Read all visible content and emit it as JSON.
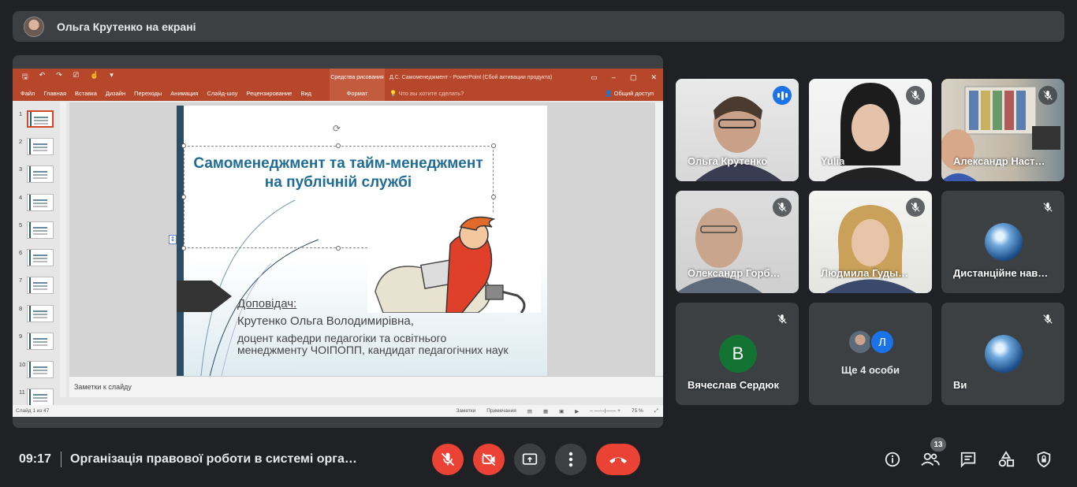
{
  "presenter": {
    "name": "Ольга Крутенко на екрані"
  },
  "ppt": {
    "context_tab": "Средства рисования",
    "doc_title": "Д.С. Самоменеджмент - PowerPoint (Сбой активации продукта)",
    "ribbon_tabs": [
      "Файл",
      "Главная",
      "Вставка",
      "Дизайн",
      "Переходы",
      "Анимация",
      "Слайд-шоу",
      "Рецензирование",
      "Вид"
    ],
    "format_tab": "Формат",
    "tell_me": "Что вы хотите сделать?",
    "share": "Общий доступ",
    "thumb_numbers": [
      "1",
      "2",
      "3",
      "4",
      "5",
      "6",
      "7",
      "8",
      "9",
      "10",
      "11"
    ],
    "slide": {
      "title": "Самоменеджмент та тайм-менеджмент на публічній службі",
      "speaker_label": "Доповідач:",
      "speaker_name": "Крутенко Ольга Володимирівна,",
      "speaker_position": "доцент кафедри педагогіки та освітнього менеджменту ЧОІПОПП, кандидат педагогічних наук"
    },
    "notes_placeholder": "Заметки к слайду",
    "status_left": "Слайд 1 из 47",
    "status_notes": "Заметки",
    "status_comments": "Примечания",
    "zoom": "75 %"
  },
  "participants": [
    {
      "name": "Ольга Крутенко",
      "speaking": true
    },
    {
      "name": "Yulia",
      "muted": true
    },
    {
      "name": "Александр Наст…",
      "muted": true
    },
    {
      "name": "Олександр Горб…",
      "muted": true
    },
    {
      "name": "Людмила Гуды…",
      "muted": true
    },
    {
      "name": "Дистанційне нав…",
      "muted": true
    },
    {
      "name": "Вячеслав Сердюк",
      "muted": true,
      "initial": "В"
    },
    {
      "name": "Ще 4 особи",
      "extra_initial": "Л"
    },
    {
      "name": "Ви",
      "muted": true
    }
  ],
  "bottom": {
    "time": "09:17",
    "meeting_title": "Організація правової роботи в системі орга…",
    "people_count": "13"
  },
  "colors": {
    "end_call": "#ea4335",
    "speaker_highlight": "#8ab4f8",
    "ppt_brand": "#b7472a"
  }
}
